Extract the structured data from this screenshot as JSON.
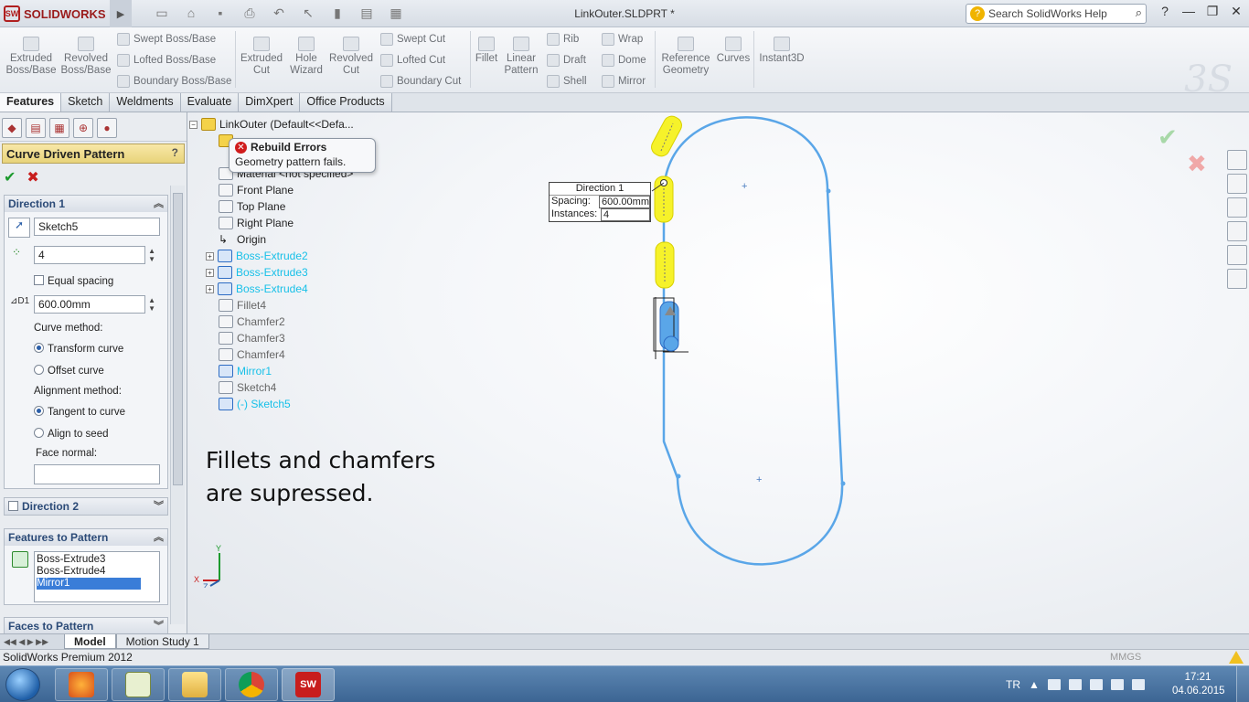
{
  "app": {
    "logo_text": "SOLIDWORKS",
    "doc_title": "LinkOuter.SLDPRT *",
    "search_placeholder": "Search SolidWorks Help"
  },
  "commands": {
    "extruded_boss": "Extruded Boss/Base",
    "revolved_boss": "Revolved Boss/Base",
    "swept_boss": "Swept Boss/Base",
    "lofted_boss": "Lofted Boss/Base",
    "boundary_boss": "Boundary Boss/Base",
    "extruded_cut": "Extruded Cut",
    "hole_wizard": "Hole Wizard",
    "revolved_cut": "Revolved Cut",
    "swept_cut": "Swept Cut",
    "lofted_cut": "Lofted Cut",
    "boundary_cut": "Boundary Cut",
    "fillet": "Fillet",
    "linear_pattern": "Linear Pattern",
    "rib": "Rib",
    "draft": "Draft",
    "shell": "Shell",
    "wrap": "Wrap",
    "dome": "Dome",
    "mirror": "Mirror",
    "reference_geometry": "Reference Geometry",
    "curves": "Curves",
    "instant3d": "Instant3D"
  },
  "tabs": [
    "Features",
    "Sketch",
    "Weldments",
    "Evaluate",
    "DimXpert",
    "Office Products"
  ],
  "property_manager": {
    "title": "Curve Driven Pattern",
    "direction1": {
      "header": "Direction 1",
      "curve": "Sketch5",
      "instances": "4",
      "equal_spacing": "Equal spacing",
      "spacing": "600.00mm",
      "curve_method_label": "Curve method:",
      "transform_curve": "Transform curve",
      "offset_curve": "Offset curve",
      "alignment_label": "Alignment method:",
      "tangent": "Tangent to curve",
      "align_seed": "Align to seed",
      "face_normal": "Face normal:"
    },
    "direction2": {
      "header": "Direction 2"
    },
    "features": {
      "header": "Features to Pattern",
      "items": [
        "Boss-Extrude3",
        "Boss-Extrude4",
        "Mirror1"
      ]
    },
    "faces": {
      "header": "Faces to Pattern"
    }
  },
  "tree": {
    "root": "LinkOuter  (Default<<Defa...",
    "items": [
      "Material <not specified>",
      "Front Plane",
      "Top Plane",
      "Right Plane",
      "Origin",
      "Boss-Extrude2",
      "Boss-Extrude3",
      "Boss-Extrude4",
      "Fillet4",
      "Chamfer2",
      "Chamfer3",
      "Chamfer4",
      "Mirror1",
      "Sketch4",
      "(-) Sketch5"
    ]
  },
  "tooltip": {
    "title": "Rebuild Errors",
    "message": "Geometry pattern fails."
  },
  "callout": {
    "title": "Direction 1",
    "spacing_label": "Spacing:",
    "spacing_value": "600.00mm",
    "instances_label": "Instances:",
    "instances_value": "4"
  },
  "annotation": {
    "line1": "Fillets and chamfers",
    "line2": "are supressed."
  },
  "triad": {
    "x": "X",
    "y": "Y",
    "z": "Z"
  },
  "bottom_tabs": [
    "Model",
    "Motion Study 1"
  ],
  "status": {
    "product": "SolidWorks Premium 2012",
    "units": "MMGS"
  },
  "taskbar": {
    "lang": "TR",
    "time": "17:21",
    "date": "04.06.2015"
  }
}
